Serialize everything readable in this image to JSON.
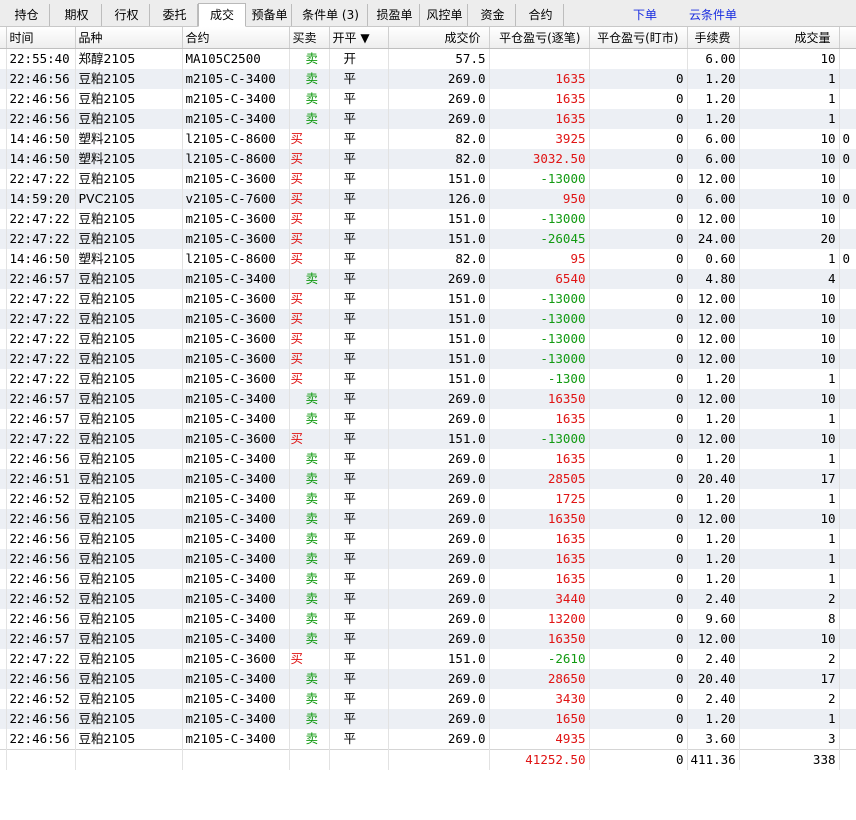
{
  "tabs": [
    {
      "label": "持仓"
    },
    {
      "label": "期权"
    },
    {
      "label": "行权"
    },
    {
      "label": "委托"
    },
    {
      "label": "成交"
    },
    {
      "label": "预备单"
    },
    {
      "label": "条件单 (3)"
    },
    {
      "label": "损盈单"
    },
    {
      "label": "风控单"
    },
    {
      "label": "资金"
    },
    {
      "label": "合约"
    }
  ],
  "links": {
    "order": "下单",
    "cloud_condition": "云条件单"
  },
  "columns": [
    "时间",
    "品种",
    "合约",
    "买卖",
    "开平 ▼",
    "成交价",
    "平仓盈亏(逐笔)",
    "平仓盈亏(盯市)",
    "手续费",
    "成交量"
  ],
  "colors": {
    "buy": "#e01414",
    "sell": "#129a12",
    "profit": "#e01414",
    "loss": "#129a12"
  },
  "rows": [
    {
      "time": "22:55:40",
      "product": "郑醇2105",
      "contract": "MA105C2500",
      "side": "卖",
      "oc": "开",
      "price": "57.5",
      "pl_trade": "",
      "pl_mark": "",
      "fee": "6.00",
      "qty": "10",
      "extra": ""
    },
    {
      "time": "22:46:56",
      "product": "豆粕2105",
      "contract": "m2105-C-3400",
      "side": "卖",
      "oc": "平",
      "price": "269.0",
      "pl_trade": "1635",
      "pl_mark": "0",
      "fee": "1.20",
      "qty": "1",
      "extra": ""
    },
    {
      "time": "22:46:56",
      "product": "豆粕2105",
      "contract": "m2105-C-3400",
      "side": "卖",
      "oc": "平",
      "price": "269.0",
      "pl_trade": "1635",
      "pl_mark": "0",
      "fee": "1.20",
      "qty": "1",
      "extra": ""
    },
    {
      "time": "22:46:56",
      "product": "豆粕2105",
      "contract": "m2105-C-3400",
      "side": "卖",
      "oc": "平",
      "price": "269.0",
      "pl_trade": "1635",
      "pl_mark": "0",
      "fee": "1.20",
      "qty": "1",
      "extra": ""
    },
    {
      "time": "14:46:50",
      "product": "塑料2105",
      "contract": "l2105-C-8600",
      "side": "买",
      "oc": "平",
      "price": "82.0",
      "pl_trade": "3925",
      "pl_mark": "0",
      "fee": "6.00",
      "qty": "10",
      "extra": "0"
    },
    {
      "time": "14:46:50",
      "product": "塑料2105",
      "contract": "l2105-C-8600",
      "side": "买",
      "oc": "平",
      "price": "82.0",
      "pl_trade": "3032.50",
      "pl_mark": "0",
      "fee": "6.00",
      "qty": "10",
      "extra": "0"
    },
    {
      "time": "22:47:22",
      "product": "豆粕2105",
      "contract": "m2105-C-3600",
      "side": "买",
      "oc": "平",
      "price": "151.0",
      "pl_trade": "-13000",
      "pl_mark": "0",
      "fee": "12.00",
      "qty": "10",
      "extra": ""
    },
    {
      "time": "14:59:20",
      "product": "PVC2105",
      "contract": "v2105-C-7600",
      "side": "买",
      "oc": "平",
      "price": "126.0",
      "pl_trade": "950",
      "pl_mark": "0",
      "fee": "6.00",
      "qty": "10",
      "extra": "0"
    },
    {
      "time": "22:47:22",
      "product": "豆粕2105",
      "contract": "m2105-C-3600",
      "side": "买",
      "oc": "平",
      "price": "151.0",
      "pl_trade": "-13000",
      "pl_mark": "0",
      "fee": "12.00",
      "qty": "10",
      "extra": ""
    },
    {
      "time": "22:47:22",
      "product": "豆粕2105",
      "contract": "m2105-C-3600",
      "side": "买",
      "oc": "平",
      "price": "151.0",
      "pl_trade": "-26045",
      "pl_mark": "0",
      "fee": "24.00",
      "qty": "20",
      "extra": ""
    },
    {
      "time": "14:46:50",
      "product": "塑料2105",
      "contract": "l2105-C-8600",
      "side": "买",
      "oc": "平",
      "price": "82.0",
      "pl_trade": "95",
      "pl_mark": "0",
      "fee": "0.60",
      "qty": "1",
      "extra": "0"
    },
    {
      "time": "22:46:57",
      "product": "豆粕2105",
      "contract": "m2105-C-3400",
      "side": "卖",
      "oc": "平",
      "price": "269.0",
      "pl_trade": "6540",
      "pl_mark": "0",
      "fee": "4.80",
      "qty": "4",
      "extra": ""
    },
    {
      "time": "22:47:22",
      "product": "豆粕2105",
      "contract": "m2105-C-3600",
      "side": "买",
      "oc": "平",
      "price": "151.0",
      "pl_trade": "-13000",
      "pl_mark": "0",
      "fee": "12.00",
      "qty": "10",
      "extra": ""
    },
    {
      "time": "22:47:22",
      "product": "豆粕2105",
      "contract": "m2105-C-3600",
      "side": "买",
      "oc": "平",
      "price": "151.0",
      "pl_trade": "-13000",
      "pl_mark": "0",
      "fee": "12.00",
      "qty": "10",
      "extra": ""
    },
    {
      "time": "22:47:22",
      "product": "豆粕2105",
      "contract": "m2105-C-3600",
      "side": "买",
      "oc": "平",
      "price": "151.0",
      "pl_trade": "-13000",
      "pl_mark": "0",
      "fee": "12.00",
      "qty": "10",
      "extra": ""
    },
    {
      "time": "22:47:22",
      "product": "豆粕2105",
      "contract": "m2105-C-3600",
      "side": "买",
      "oc": "平",
      "price": "151.0",
      "pl_trade": "-13000",
      "pl_mark": "0",
      "fee": "12.00",
      "qty": "10",
      "extra": ""
    },
    {
      "time": "22:47:22",
      "product": "豆粕2105",
      "contract": "m2105-C-3600",
      "side": "买",
      "oc": "平",
      "price": "151.0",
      "pl_trade": "-1300",
      "pl_mark": "0",
      "fee": "1.20",
      "qty": "1",
      "extra": ""
    },
    {
      "time": "22:46:57",
      "product": "豆粕2105",
      "contract": "m2105-C-3400",
      "side": "卖",
      "oc": "平",
      "price": "269.0",
      "pl_trade": "16350",
      "pl_mark": "0",
      "fee": "12.00",
      "qty": "10",
      "extra": ""
    },
    {
      "time": "22:46:57",
      "product": "豆粕2105",
      "contract": "m2105-C-3400",
      "side": "卖",
      "oc": "平",
      "price": "269.0",
      "pl_trade": "1635",
      "pl_mark": "0",
      "fee": "1.20",
      "qty": "1",
      "extra": ""
    },
    {
      "time": "22:47:22",
      "product": "豆粕2105",
      "contract": "m2105-C-3600",
      "side": "买",
      "oc": "平",
      "price": "151.0",
      "pl_trade": "-13000",
      "pl_mark": "0",
      "fee": "12.00",
      "qty": "10",
      "extra": ""
    },
    {
      "time": "22:46:56",
      "product": "豆粕2105",
      "contract": "m2105-C-3400",
      "side": "卖",
      "oc": "平",
      "price": "269.0",
      "pl_trade": "1635",
      "pl_mark": "0",
      "fee": "1.20",
      "qty": "1",
      "extra": ""
    },
    {
      "time": "22:46:51",
      "product": "豆粕2105",
      "contract": "m2105-C-3400",
      "side": "卖",
      "oc": "平",
      "price": "269.0",
      "pl_trade": "28505",
      "pl_mark": "0",
      "fee": "20.40",
      "qty": "17",
      "extra": ""
    },
    {
      "time": "22:46:52",
      "product": "豆粕2105",
      "contract": "m2105-C-3400",
      "side": "卖",
      "oc": "平",
      "price": "269.0",
      "pl_trade": "1725",
      "pl_mark": "0",
      "fee": "1.20",
      "qty": "1",
      "extra": ""
    },
    {
      "time": "22:46:56",
      "product": "豆粕2105",
      "contract": "m2105-C-3400",
      "side": "卖",
      "oc": "平",
      "price": "269.0",
      "pl_trade": "16350",
      "pl_mark": "0",
      "fee": "12.00",
      "qty": "10",
      "extra": ""
    },
    {
      "time": "22:46:56",
      "product": "豆粕2105",
      "contract": "m2105-C-3400",
      "side": "卖",
      "oc": "平",
      "price": "269.0",
      "pl_trade": "1635",
      "pl_mark": "0",
      "fee": "1.20",
      "qty": "1",
      "extra": ""
    },
    {
      "time": "22:46:56",
      "product": "豆粕2105",
      "contract": "m2105-C-3400",
      "side": "卖",
      "oc": "平",
      "price": "269.0",
      "pl_trade": "1635",
      "pl_mark": "0",
      "fee": "1.20",
      "qty": "1",
      "extra": ""
    },
    {
      "time": "22:46:56",
      "product": "豆粕2105",
      "contract": "m2105-C-3400",
      "side": "卖",
      "oc": "平",
      "price": "269.0",
      "pl_trade": "1635",
      "pl_mark": "0",
      "fee": "1.20",
      "qty": "1",
      "extra": ""
    },
    {
      "time": "22:46:52",
      "product": "豆粕2105",
      "contract": "m2105-C-3400",
      "side": "卖",
      "oc": "平",
      "price": "269.0",
      "pl_trade": "3440",
      "pl_mark": "0",
      "fee": "2.40",
      "qty": "2",
      "extra": ""
    },
    {
      "time": "22:46:56",
      "product": "豆粕2105",
      "contract": "m2105-C-3400",
      "side": "卖",
      "oc": "平",
      "price": "269.0",
      "pl_trade": "13200",
      "pl_mark": "0",
      "fee": "9.60",
      "qty": "8",
      "extra": ""
    },
    {
      "time": "22:46:57",
      "product": "豆粕2105",
      "contract": "m2105-C-3400",
      "side": "卖",
      "oc": "平",
      "price": "269.0",
      "pl_trade": "16350",
      "pl_mark": "0",
      "fee": "12.00",
      "qty": "10",
      "extra": ""
    },
    {
      "time": "22:47:22",
      "product": "豆粕2105",
      "contract": "m2105-C-3600",
      "side": "买",
      "oc": "平",
      "price": "151.0",
      "pl_trade": "-2610",
      "pl_mark": "0",
      "fee": "2.40",
      "qty": "2",
      "extra": ""
    },
    {
      "time": "22:46:56",
      "product": "豆粕2105",
      "contract": "m2105-C-3400",
      "side": "卖",
      "oc": "平",
      "price": "269.0",
      "pl_trade": "28650",
      "pl_mark": "0",
      "fee": "20.40",
      "qty": "17",
      "extra": ""
    },
    {
      "time": "22:46:52",
      "product": "豆粕2105",
      "contract": "m2105-C-3400",
      "side": "卖",
      "oc": "平",
      "price": "269.0",
      "pl_trade": "3430",
      "pl_mark": "0",
      "fee": "2.40",
      "qty": "2",
      "extra": ""
    },
    {
      "time": "22:46:56",
      "product": "豆粕2105",
      "contract": "m2105-C-3400",
      "side": "卖",
      "oc": "平",
      "price": "269.0",
      "pl_trade": "1650",
      "pl_mark": "0",
      "fee": "1.20",
      "qty": "1",
      "extra": ""
    },
    {
      "time": "22:46:56",
      "product": "豆粕2105",
      "contract": "m2105-C-3400",
      "side": "卖",
      "oc": "平",
      "price": "269.0",
      "pl_trade": "4935",
      "pl_mark": "0",
      "fee": "3.60",
      "qty": "3",
      "extra": ""
    }
  ],
  "totals": {
    "pl_trade": "41252.50",
    "pl_mark": "0",
    "fee": "411.36",
    "qty": "338"
  }
}
